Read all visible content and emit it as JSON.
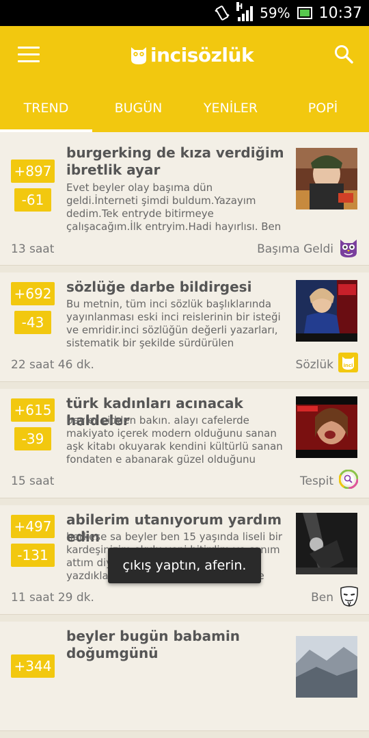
{
  "status_bar": {
    "battery": "59%",
    "time": "10:37",
    "network": "H",
    "icons": [
      "vibrate-icon",
      "signal-icon",
      "battery-icon"
    ]
  },
  "app": {
    "logo_text": "incisözlük",
    "brand_color": "#f2c80f",
    "menu_icon": "hamburger-icon",
    "search_icon": "search-icon"
  },
  "tabs": [
    {
      "label": "TREND",
      "active": true
    },
    {
      "label": "BUGÜN",
      "active": false
    },
    {
      "label": "YENİLER",
      "active": false
    },
    {
      "label": "POPİ",
      "active": false
    }
  ],
  "entries": [
    {
      "up": "+897",
      "down": "-61",
      "title": "burgerking de kıza verdiğim ibretlik ayar",
      "excerpt": "Evet beyler olay başıma dün geldi.İnterneti şimdi buldum.Yazayım dedim.Tek entryde bitirmeye çalışacağım.İlk entryim.Hadi hayırlısı. Ben haftada bir ya da",
      "time": "13 saat",
      "category": "Başıma Geldi",
      "category_icon": "owl-icon"
    },
    {
      "up": "+692",
      "down": "-43",
      "title": "sözlüğe darbe bildirgesi",
      "excerpt": "Bu metnin, tüm inci sözlük başlıklarında yayınlanması eski inci reislerinin bir isteği ve emridir.inci sözlüğün değerli yazarları, sistematik bir şekilde sürdürülen",
      "time": "22 saat 46 dk.",
      "category": "Sözlük",
      "category_icon": "inci-logo-icon"
    },
    {
      "up": "+615",
      "down": "-39",
      "title": "türk kadınları acınacak haldeler",
      "excerpt": "beyler cidden bakın. alayı cafelerde makiyato içerek modern olduğunu sanan aşk kitabı okuyarak kendini kültürlü sanan fondaten e abanarak güzel olduğunu",
      "time": "15 saat",
      "category": "Tespit",
      "category_icon": "tespit-icon"
    },
    {
      "up": "+497",
      "down": "-131",
      "title": "abilerim utanıyorum yardım edin",
      "excerpt": "herkese sa beyler ben 15 yaşında liseli bir kardeşinizim okulu yeni bitirdim ve canım attım diye ve kesinlikle burada yazdıklarıma rağmen mımda kesinlikle haddi",
      "time": "11 saat 29 dk.",
      "category": "Ben",
      "category_icon": "mask-icon"
    },
    {
      "up": "+344",
      "down": "",
      "title": "beyler bugün babamin doğumgünü",
      "excerpt": "",
      "time": "",
      "category": "",
      "category_icon": ""
    }
  ],
  "toast": "çıkış yaptın, aferin."
}
